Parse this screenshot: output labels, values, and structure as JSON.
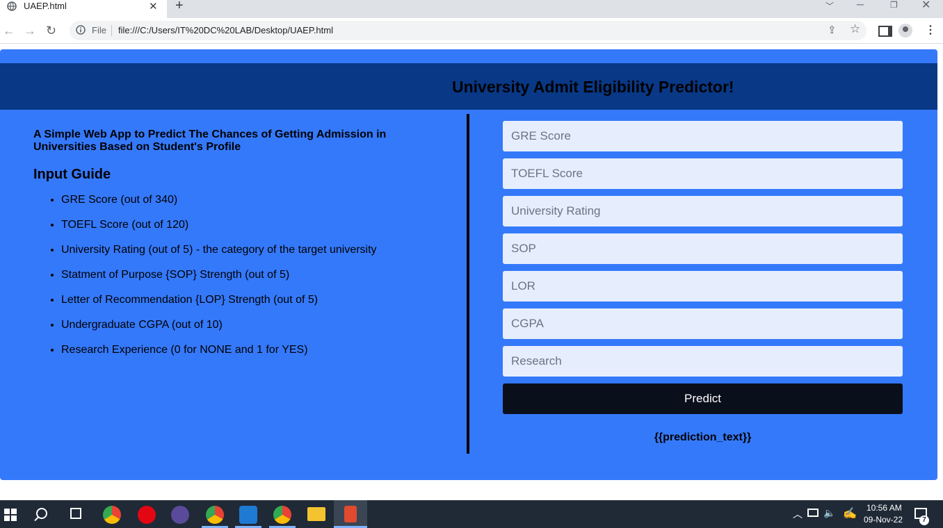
{
  "browser": {
    "tab_title": "UAEP.html",
    "new_tab_symbol": "+",
    "protocol_label": "File",
    "url": "file:///C:/Users/IT%20DC%20LAB/Desktop/UAEP.html",
    "icons": [
      "globe-icon",
      "close-icon",
      "back-arrow-icon",
      "forward-arrow-icon",
      "reload-icon",
      "info-icon",
      "share-icon",
      "star-icon",
      "side-panel-icon",
      "profile-icon",
      "kebab-menu-icon"
    ]
  },
  "page": {
    "title": "University Admit Eligibility Predictor!",
    "intro": "A Simple Web App to Predict The Chances of Getting Admission in Universities Based on Student's Profile",
    "guide_title": "Input Guide",
    "guide_items": [
      "GRE Score (out of 340)",
      "TOEFL Score (out of 120)",
      "University Rating (out of 5) - the category of the target university",
      "Statment of Purpose {SOP} Strength (out of 5)",
      "Letter of Recommendation {LOP} Strength (out of 5)",
      "Undergraduate CGPA (out of 10)",
      "Research Experience (0 for NONE and 1 for YES)"
    ],
    "form": {
      "gre_placeholder": "GRE Score",
      "toefl_placeholder": "TOEFL Score",
      "rating_placeholder": "University Rating",
      "sop_placeholder": "SOP",
      "lor_placeholder": "LOR",
      "cgpa_placeholder": "CGPA",
      "research_placeholder": "Research",
      "predict_label": "Predict"
    },
    "prediction_text": "{{prediction_text}}",
    "colors": {
      "background": "#3579fb",
      "header": "#093886",
      "button": "#0a0f1c",
      "input": "#e6eefe"
    }
  },
  "taskbar": {
    "time": "10:56 AM",
    "date": "09-Nov-22",
    "notification_count": "7",
    "icons": [
      "windows-start-icon",
      "search-icon",
      "task-view-icon",
      "chrome-icon",
      "opera-icon",
      "eclipse-icon",
      "chrome-profile-icon",
      "vscode-icon",
      "chrome-icon",
      "file-explorer-icon",
      "app-icon"
    ]
  }
}
